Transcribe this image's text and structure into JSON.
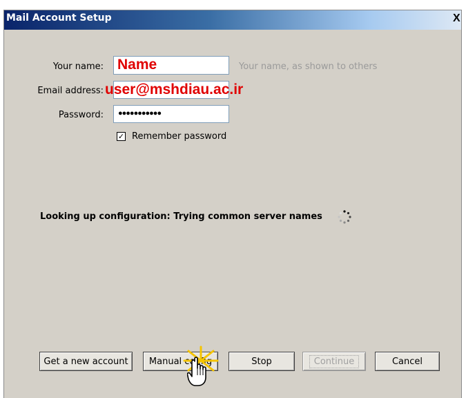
{
  "window": {
    "title": "Mail Account Setup",
    "close_label": "X"
  },
  "form": {
    "name_label": "Your name:",
    "name_value": "Name",
    "name_hint": "Your name, as shown to others",
    "email_label": "Email address:",
    "email_value": "user@mshdiau.ac.ir",
    "password_label": "Password:",
    "password_value": "●●●●●●●●●●●",
    "remember_label": "Remember password",
    "remember_checked": true
  },
  "status": {
    "text": "Looking up configuration: Trying common server names"
  },
  "buttons": {
    "get_new_account": "Get a new account",
    "manual_config": "Manual config",
    "stop": "Stop",
    "continue": "Continue",
    "cancel": "Cancel"
  }
}
